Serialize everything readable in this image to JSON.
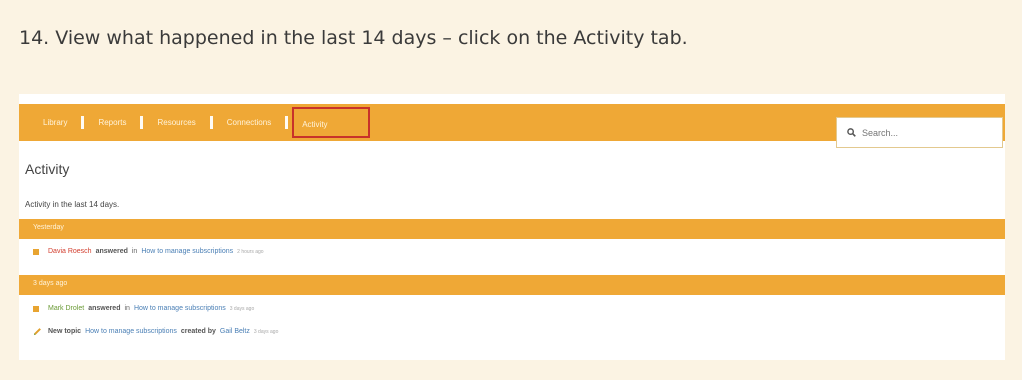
{
  "instruction": "14. View what happened in the last 14 days – click on the Activity tab.",
  "navbar": {
    "tabs": [
      "Library",
      "Reports",
      "Resources",
      "Connections",
      "Activity"
    ],
    "active_tab": "Activity",
    "search_placeholder": "Search..."
  },
  "page": {
    "title": "Activity",
    "subtitle": "Activity in the last 14 days."
  },
  "sections": [
    {
      "header": "Yesterday",
      "items": [
        {
          "user": "Davia Roesch",
          "verb": "answered",
          "prep": "in",
          "link": "How to manage subscriptions",
          "time": "2 hours ago"
        }
      ]
    },
    {
      "header": "3 days ago",
      "items": [
        {
          "user": "Mark Drolet",
          "verb": "answered",
          "prep": "in",
          "link": "How to manage subscriptions",
          "time": "3 days ago"
        },
        {
          "lead": "New topic",
          "link": "How to manage subscriptions",
          "verb": "created by",
          "user": "Gail Beltz",
          "time": "3 days ago"
        }
      ]
    }
  ],
  "colors": {
    "accent": "#efa836",
    "highlight": "#c8322a",
    "background": "#fbf3e3"
  }
}
